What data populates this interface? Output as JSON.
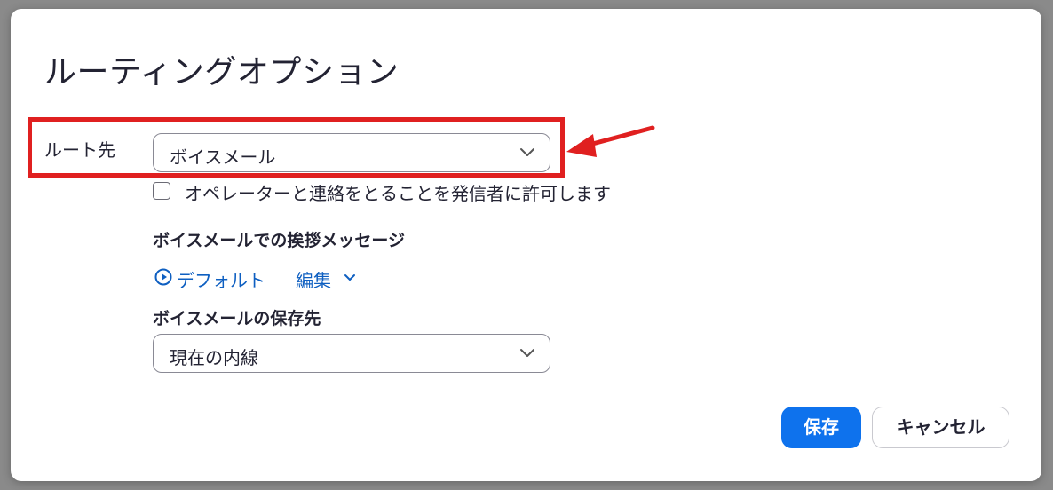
{
  "dialog": {
    "title": "ルーティングオプション",
    "route_label": "ルート先",
    "route_select_value": "ボイスメール",
    "allow_operator_label": "オペレーターと連絡をとることを発信者に許可します",
    "greeting_label": "ボイスメールでの挨拶メッセージ",
    "greeting_default_link": "デフォルト",
    "greeting_edit_link": "編集",
    "storage_label": "ボイスメールの保存先",
    "storage_select_value": "現在の内線",
    "save_button": "保存",
    "cancel_button": "キャンセル"
  },
  "annotation": {
    "highlight_color": "#e02020"
  },
  "colors": {
    "primary": "#0e72ed",
    "link": "#0e5fc1",
    "text": "#232333"
  },
  "icons": [
    "chevron-down-icon",
    "play-circle-icon",
    "checkbox-icon",
    "annotation-arrow-icon"
  ]
}
